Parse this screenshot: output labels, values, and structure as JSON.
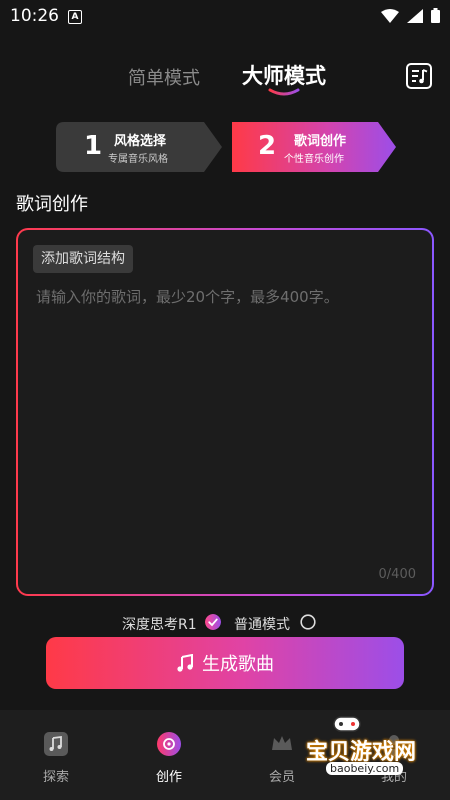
{
  "status": {
    "time": "10:26",
    "a_icon": "A"
  },
  "mode_tabs": {
    "simple": "简单模式",
    "master": "大师模式"
  },
  "steps": [
    {
      "number": "1",
      "title": "风格选择",
      "subtitle": "专属音乐风格"
    },
    {
      "number": "2",
      "title": "歌词创作",
      "subtitle": "个性音乐创作"
    }
  ],
  "lyrics": {
    "section_title": "歌词创作",
    "structure_button": "添加歌词结构",
    "placeholder": "请输入你的歌词，最少20个字，最多400字。",
    "value": "",
    "count": "0/400"
  },
  "options": {
    "deep_think": "深度思考R1",
    "normal_mode": "普通模式"
  },
  "generate_label": "生成歌曲",
  "nav": {
    "explore": "探索",
    "create": "创作",
    "member": "会员",
    "mine": "我的"
  },
  "watermark": {
    "text": "宝贝游戏网",
    "url": "baobeiy.com"
  },
  "colors": {
    "accent_red": "#ff3a47",
    "accent_purple": "#9c4ee8",
    "background": "#161616"
  }
}
